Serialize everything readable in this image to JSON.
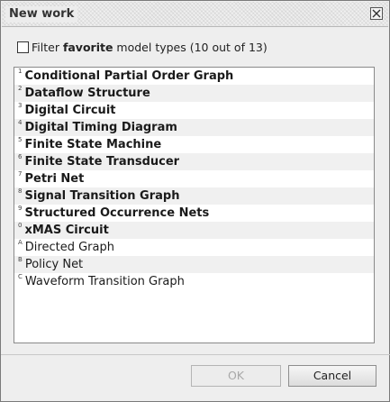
{
  "window": {
    "title": "New work"
  },
  "filter": {
    "checked": false,
    "prefix": "Filter ",
    "bold": "favorite",
    "suffix": " model types (10 out of 13)"
  },
  "items": [
    {
      "key": "1",
      "label": "Conditional Partial Order Graph",
      "favorite": true
    },
    {
      "key": "2",
      "label": "Dataflow Structure",
      "favorite": true
    },
    {
      "key": "3",
      "label": "Digital Circuit",
      "favorite": true
    },
    {
      "key": "4",
      "label": "Digital Timing Diagram",
      "favorite": true
    },
    {
      "key": "5",
      "label": "Finite State Machine",
      "favorite": true
    },
    {
      "key": "6",
      "label": "Finite State Transducer",
      "favorite": true
    },
    {
      "key": "7",
      "label": "Petri Net",
      "favorite": true
    },
    {
      "key": "8",
      "label": "Signal Transition Graph",
      "favorite": true
    },
    {
      "key": "9",
      "label": "Structured Occurrence Nets",
      "favorite": true
    },
    {
      "key": "0",
      "label": "xMAS Circuit",
      "favorite": true
    },
    {
      "key": "A",
      "label": "Directed Graph",
      "favorite": false
    },
    {
      "key": "B",
      "label": "Policy Net",
      "favorite": false
    },
    {
      "key": "C",
      "label": "Waveform Transition Graph",
      "favorite": false
    }
  ],
  "buttons": {
    "ok": "OK",
    "ok_enabled": false,
    "cancel": "Cancel"
  },
  "icons": {
    "close": "close-icon"
  }
}
